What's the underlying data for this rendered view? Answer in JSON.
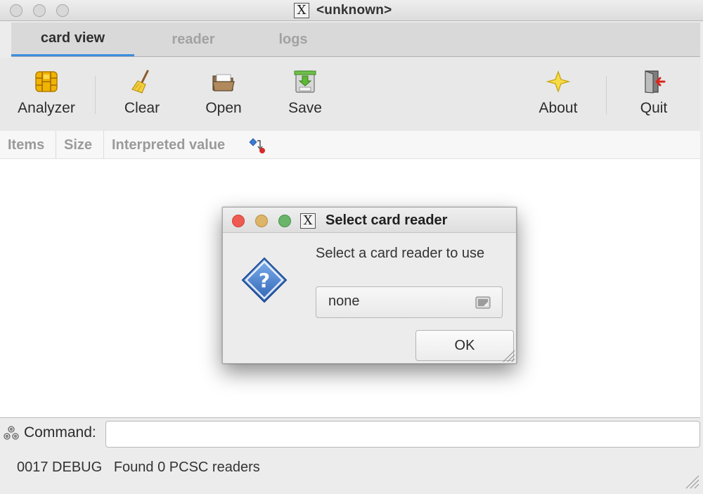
{
  "window": {
    "title": "<unknown>",
    "x_logo": "X"
  },
  "tabs": [
    {
      "label": "card view",
      "active": true
    },
    {
      "label": "reader",
      "active": false
    },
    {
      "label": "logs",
      "active": false
    }
  ],
  "toolbar": {
    "analyzer_label": "Analyzer",
    "clear_label": "Clear",
    "open_label": "Open",
    "save_label": "Save",
    "about_label": "About",
    "quit_label": "Quit",
    "icons": {
      "analyzer": "smartcard-chip-icon",
      "clear": "broom-icon",
      "open": "folder-open-icon",
      "save": "save-disk-icon",
      "about": "star-icon",
      "quit": "exit-door-icon"
    }
  },
  "columns": {
    "items": "Items",
    "size": "Size",
    "interpreted_value": "Interpreted value",
    "extra_icon": "column-options-icon"
  },
  "command": {
    "label": "Command:",
    "value": "",
    "icon": "gear-cluster-icon"
  },
  "status": {
    "text": "0017 DEBUG   Found 0 PCSC readers"
  },
  "dialog": {
    "title": "Select card reader",
    "x_logo": "X",
    "prompt": "Select a card reader to use",
    "icon": "question-icon",
    "select_value": "none",
    "ok_label": "OK"
  },
  "colors": {
    "tab_active_underline": "#3b8ede",
    "dialog_close": "#ee5b52",
    "dialog_minimize": "#dcb46a",
    "dialog_zoom": "#69b56a",
    "question_blue": "#3e7cc9"
  }
}
